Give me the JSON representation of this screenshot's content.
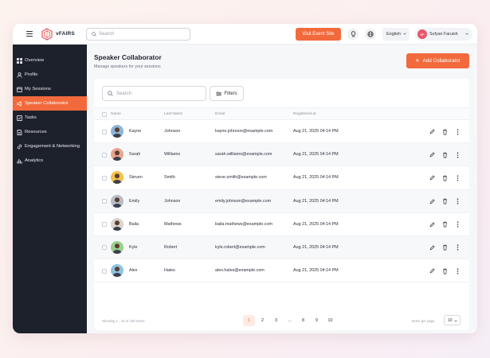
{
  "header": {
    "logo_text": "vFAIRS",
    "search_placeholder": "Search",
    "visit_button": "Visit Event Site",
    "language": "English",
    "user_initials": "SF",
    "user_name": "Sufyan Faruish"
  },
  "sidebar": {
    "items": [
      {
        "label": "Overview",
        "icon": "grid-icon"
      },
      {
        "label": "Profile",
        "icon": "user-icon"
      },
      {
        "label": "My Sessions",
        "icon": "calendar-icon"
      },
      {
        "label": "Speaker Collaborator",
        "icon": "speaker-icon",
        "active": true
      },
      {
        "label": "Tasks",
        "icon": "checklist-icon"
      },
      {
        "label": "Resources",
        "icon": "document-icon"
      },
      {
        "label": "Engagement & Networking",
        "icon": "link-icon"
      },
      {
        "label": "Analytics",
        "icon": "bar-chart-icon"
      }
    ]
  },
  "page": {
    "title": "Speaker Collaborator",
    "subtitle": "Manage speakers for your sessions",
    "add_button": "Add Collaborator"
  },
  "table": {
    "search_placeholder": "Search",
    "filter_button": "Filters",
    "columns": [
      "Name",
      "Last Name",
      "Email",
      "Registered at"
    ],
    "rows": [
      {
        "first": "Kayne",
        "last": "Johnson",
        "email": "kayne.johnson@example.com",
        "registered": "Aug 21, 2025 04:14 PM",
        "avatar_color": "#8fb3d9"
      },
      {
        "first": "Sarah",
        "last": "Williams",
        "email": "sarah.williams@example.com",
        "registered": "Aug 21, 2025 04:14 PM",
        "avatar_color": "#e9a48f"
      },
      {
        "first": "Steven",
        "last": "Smith",
        "email": "steve.smith@example.com",
        "registered": "Aug 21, 2025 04:14 PM",
        "avatar_color": "#f2c14a"
      },
      {
        "first": "Emily",
        "last": "Johnson",
        "email": "emily.johnson@example.com",
        "registered": "Aug 21, 2025 04:14 PM",
        "avatar_color": "#b8bcc6"
      },
      {
        "first": "Baila",
        "last": "Mathews",
        "email": "baila.mathews@example.com",
        "registered": "Aug 21, 2025 04:14 PM",
        "avatar_color": "#d9d4cf"
      },
      {
        "first": "Kyle",
        "last": "Robert",
        "email": "kyle.robert@example.com",
        "registered": "Aug 21, 2025 04:14 PM",
        "avatar_color": "#9bd08a"
      },
      {
        "first": "Alex",
        "last": "Hales",
        "email": "alex.hales@example.com",
        "registered": "Aug 21, 2025 04:14 PM",
        "avatar_color": "#8fc3e0"
      }
    ]
  },
  "footer": {
    "showing": "Showing 1 - 10 of 100 Items",
    "pages": [
      "1",
      "2",
      "3",
      "...",
      "8",
      "9",
      "10"
    ],
    "current_page": "1",
    "items_per_page_label": "Items per page",
    "items_per_page": "10"
  },
  "colors": {
    "accent": "#f26a3c",
    "sidebar_bg": "#1d212c"
  }
}
